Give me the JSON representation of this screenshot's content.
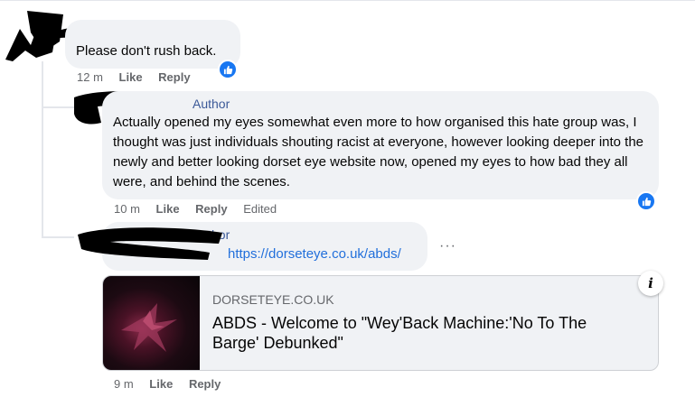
{
  "comment1": {
    "text": "Please don't rush back.",
    "time": "12 m",
    "like": "Like",
    "reply": "Reply"
  },
  "comment2": {
    "badge": "Author",
    "text": "Actually opened my eyes somewhat even more to how organised this hate group was, I thought was just individuals shouting racist at everyone, however looking deeper into the newly and better looking dorset eye website now, opened my eyes to how bad they all were, and behind the scenes.",
    "time": "10 m",
    "like": "Like",
    "reply": "Reply",
    "edited": "Edited"
  },
  "comment3": {
    "badge": "Author",
    "link": "https://dorseteye.co.uk/abds/",
    "more": "···",
    "time": "9 m",
    "like": "Like",
    "reply": "Reply"
  },
  "preview": {
    "domain": "DORSETEYE.CO.UK",
    "title": "ABDS - Welcome to \"Wey'Back Machine:'No To The Barge' Debunked\"",
    "info": "i"
  },
  "icons": {
    "reaction": "thumbs-up-icon",
    "info": "info-icon",
    "more": "more-options-icon"
  },
  "colors": {
    "accent": "#1877f2",
    "link": "#216fdb",
    "bubble": "#f0f2f5"
  }
}
